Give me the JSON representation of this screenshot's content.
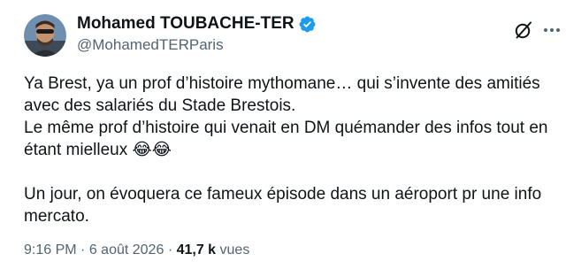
{
  "author": {
    "display_name": "Mohamed TOUBACHE-TER",
    "handle": "@MohamedTERParis",
    "verified": true
  },
  "tweet": {
    "text": "Ya Brest, ya un prof d’histoire mythomane… qui s’invente des amitiés\navec des salariés du Stade Brestois.\nLe même prof d’histoire qui venait en DM quémander des infos tout en\nétant mielleux 😂😂\n\nUn jour, on évoquera ce fameux épisode dans un aéroport pr une info\nmercato.",
    "time": "9:16 PM",
    "date": "6 août 2026",
    "separator": "·",
    "views_count": "41,7 k",
    "views_label": "vues"
  },
  "icons": {
    "verified": "verified-badge-icon",
    "grok": "grok-icon",
    "more": "more-options-icon"
  },
  "colors": {
    "text_primary": "#0f1419",
    "text_secondary": "#536471",
    "verified_blue": "#1d9bf0",
    "background": "#ffffff"
  }
}
